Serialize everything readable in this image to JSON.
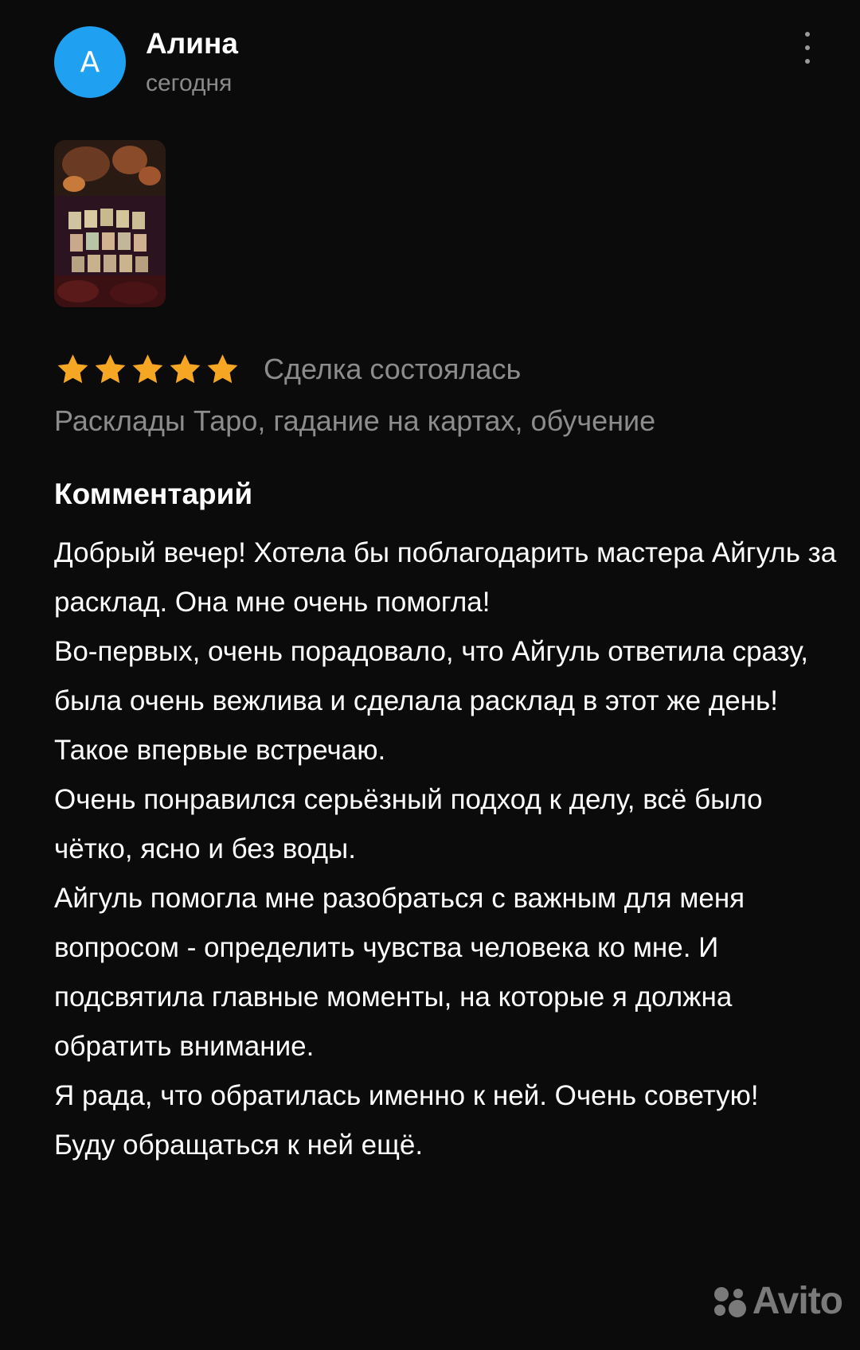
{
  "review": {
    "author": {
      "initial": "А",
      "name": "Алина",
      "date": "сегодня",
      "avatar_color": "#1fa0f0"
    },
    "menu_icon": "more-vertical-icon",
    "photo": {
      "description_icon": "review-photo-thumbnail"
    },
    "rating": {
      "stars": 5,
      "max": 5,
      "star_color": "#f5a623"
    },
    "deal_status": "Сделка состоялась",
    "service": "Расклады Таро, гадание на картах, обучение",
    "comment": {
      "title": "Комментарий",
      "lines": [
        "Добрый вечер! Хотела бы поблагодарить мастера Айгуль за расклад. Она мне очень помогла!",
        "Во-первых, очень порадовало, что Айгуль ответила сразу, была очень вежлива и сделала расклад в этот же день! Такое впервые встречаю.",
        "Очень понравился серьёзный подход к делу, всё было чётко, ясно и без воды.",
        "Айгуль помогла мне разобраться с важным для меня вопросом - определить чувства человека ко мне. И подсвятила главные моменты, на которые я должна обратить внимание.",
        "Я рада, что обратилась именно к ней. Очень советую!",
        "Буду обращаться к ней ещё."
      ]
    }
  },
  "watermark": {
    "text": "Avito"
  }
}
